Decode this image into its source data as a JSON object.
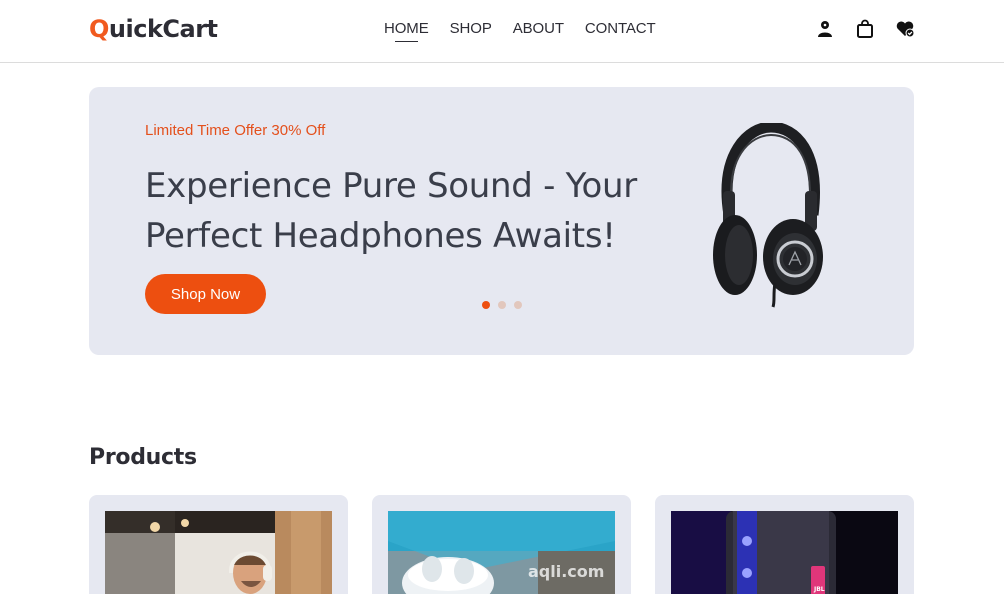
{
  "header": {
    "logo_initial": "Q",
    "logo_rest": "uickCart",
    "nav": [
      {
        "label": "HOME"
      },
      {
        "label": "SHOP"
      },
      {
        "label": "ABOUT"
      },
      {
        "label": "CONTACT"
      }
    ],
    "icons": [
      "user-icon",
      "shopping-bag-icon",
      "wishlist-heart-icon"
    ]
  },
  "hero": {
    "offer": "Limited Time Offer 30% Off",
    "headline": "Experience Pure Sound - Your Perfect Headphones Awaits!",
    "button": "Shop Now",
    "slides": 3,
    "active_slide": 1
  },
  "products": {
    "title": "Products",
    "cards": [
      {
        "image": "man-with-headphones-photo"
      },
      {
        "image": "earbuds-case-photo",
        "watermark": "aqli.com"
      },
      {
        "image": "portable-speaker-photo",
        "badge": "JBL"
      }
    ]
  },
  "colors": {
    "accent": "#ed4f10",
    "hero_bg": "#e6e8f1",
    "text": "#2d2d35"
  }
}
